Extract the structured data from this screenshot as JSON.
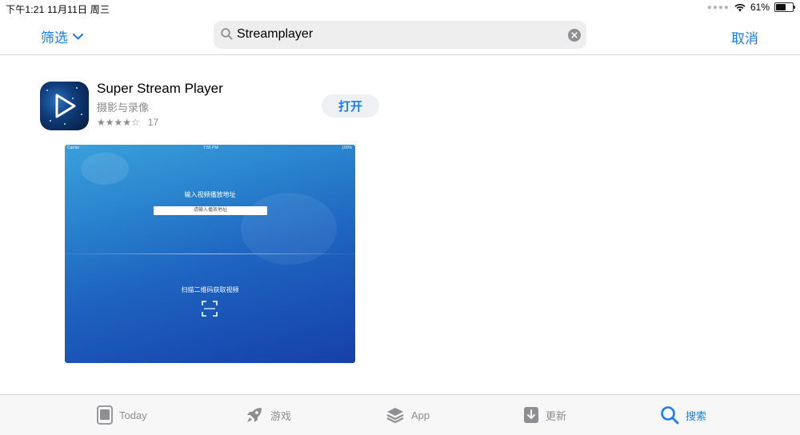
{
  "status_bar": {
    "time_date": "下午1:21  11月11日 周三",
    "battery_percent": "61%",
    "battery_level": 0.61
  },
  "nav": {
    "filter_label": "筛选",
    "search_value": "Streamplayer",
    "cancel_label": "取消"
  },
  "app": {
    "name": "Super Stream Player",
    "category": "摄影与录像",
    "rating_stars": "★★★★☆",
    "rating_value": 4.5,
    "rating_count": "17",
    "open_label": "打开"
  },
  "preview": {
    "status_left": "Carrier",
    "status_time": "7:55 PM",
    "status_right": "100%",
    "title": "输入视频播放地址",
    "input_placeholder": "请输入播放地址",
    "scan_label": "扫描二维码获取视频"
  },
  "tabs": [
    {
      "label": "Today",
      "icon": "today-icon",
      "active": false
    },
    {
      "label": "游戏",
      "icon": "rocket-icon",
      "active": false
    },
    {
      "label": "App",
      "icon": "layers-icon",
      "active": false
    },
    {
      "label": "更新",
      "icon": "download-icon",
      "active": false
    },
    {
      "label": "搜索",
      "icon": "search-icon",
      "active": true
    }
  ],
  "colors": {
    "accent": "#1a7cf5",
    "inactive": "#8e8e93"
  }
}
